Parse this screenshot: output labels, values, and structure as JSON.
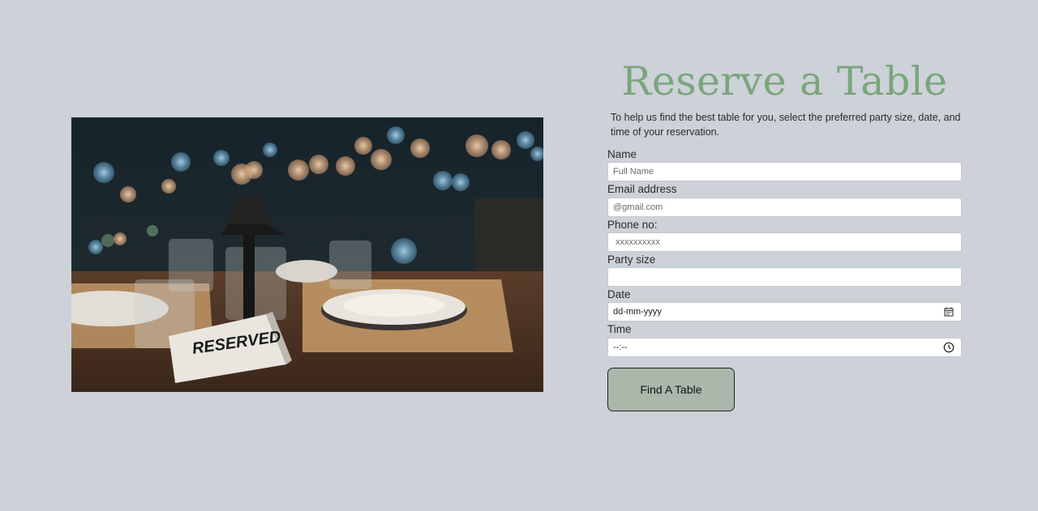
{
  "photo": {
    "sign_text": "RESERVED"
  },
  "form": {
    "title": "Reserve a Table",
    "intro": "To help us find the best table for you, select the preferred party size, date, and time of your reservation.",
    "name": {
      "label": "Name",
      "placeholder": "Full Name",
      "value": ""
    },
    "email": {
      "label": "Email address",
      "placeholder": "@gmail.com",
      "value": ""
    },
    "phone": {
      "label": "Phone no:",
      "placeholder": " xxxxxxxxxx",
      "value": ""
    },
    "party_size": {
      "label": "Party size",
      "value": ""
    },
    "date": {
      "label": "Date",
      "value": "dd-mm-yyyy",
      "icon": "calendar-icon"
    },
    "time": {
      "label": "Time",
      "value": "--:--",
      "icon": "clock-icon"
    },
    "submit_label": "Find A Table"
  },
  "colors": {
    "background": "#cdd1d8",
    "title": "#7aa57d",
    "button": "#a9b8ab"
  }
}
